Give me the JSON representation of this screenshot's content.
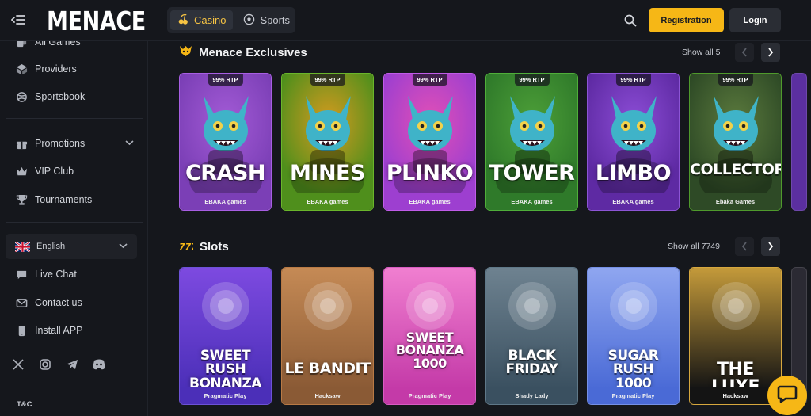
{
  "header": {
    "logo": "MENACE",
    "tabs": [
      {
        "label": "Casino",
        "icon": "cherries-icon"
      },
      {
        "label": "Sports",
        "icon": "soccer-ball-icon"
      }
    ],
    "registration_label": "Registration",
    "login_label": "Login"
  },
  "sidebar": {
    "items": [
      {
        "label": "All Games",
        "icon": "cards-icon"
      },
      {
        "label": "Providers",
        "icon": "cube-icon"
      },
      {
        "label": "Sportsbook",
        "icon": "sportsbook-icon"
      },
      {
        "label": "Promotions",
        "icon": "gift-icon"
      },
      {
        "label": "VIP Club",
        "icon": "crown-icon"
      },
      {
        "label": "Tournaments",
        "icon": "trophy-icon"
      }
    ],
    "language": "English",
    "support_items": [
      {
        "label": "Live Chat",
        "icon": "chat-icon"
      },
      {
        "label": "Contact us",
        "icon": "mail-icon"
      },
      {
        "label": "Install APP",
        "icon": "phone-icon"
      }
    ],
    "socials": [
      "x-icon",
      "instagram-icon",
      "telegram-icon",
      "discord-icon"
    ],
    "tc_label": "T&C"
  },
  "sections": [
    {
      "title": "Menace Exclusives",
      "icon": "menace-icon",
      "show_all": "Show all 5",
      "games": [
        {
          "title": "CRASH",
          "provider": "EBAKA games",
          "rtp": "99% RTP",
          "bg": "#7b3fb6",
          "accent": "#a35bd6",
          "border": "#a85ee3"
        },
        {
          "title": "MINES",
          "provider": "EBAKA games",
          "rtp": "99% RTP",
          "bg": "#4f8f1c",
          "accent": "#d59a1f",
          "border": "#6ab62b"
        },
        {
          "title": "PLINKO",
          "provider": "EBAKA games",
          "rtp": "99% RTP",
          "bg": "#9d3fd0",
          "accent": "#e24fb6",
          "border": "#c05ce8"
        },
        {
          "title": "TOWER",
          "provider": "EBAKA games",
          "rtp": "99% RTP",
          "bg": "#2f7a2a",
          "accent": "#4d9f38",
          "border": "#4fae3a"
        },
        {
          "title": "LIMBO",
          "provider": "EBAKA games",
          "rtp": "99% RTP",
          "bg": "#5e2aa3",
          "accent": "#8c4dd6",
          "border": "#8d55d6"
        },
        {
          "title": "COLLECTOR",
          "provider": "Ebaka Games",
          "rtp": "99% RTP",
          "bg": "#2e4a26",
          "accent": "#5b7a3d",
          "border": "#4f9a2c"
        }
      ]
    },
    {
      "title": "Slots",
      "icon": "slots-777-icon",
      "show_all": "Show all 7749",
      "games": [
        {
          "title": "SWEET RUSH\nBONANZA",
          "provider": "Pragmatic Play",
          "bg": "#4b2fb8",
          "accent": "#7d4ae0",
          "border": "#6d52d6"
        },
        {
          "title": "LE BANDIT",
          "provider": "Hacksaw",
          "bg": "#8a5a35",
          "accent": "#c58a55",
          "border": "#b97a45"
        },
        {
          "title": "SWEET\nBONANZA\n1000",
          "provider": "Pragmatic Play",
          "bg": "#c43aa8",
          "accent": "#f07fd0",
          "border": "#d95cc2"
        },
        {
          "title": "BLACK\nFRIDAY",
          "provider": "Shady Lady",
          "bg": "#3a5060",
          "accent": "#6e8290",
          "border": "#5f7888"
        },
        {
          "title": "SUGAR RUSH\n1000",
          "provider": "Pragmatic Play",
          "bg": "#4a6ad6",
          "accent": "#8fa6f0",
          "border": "#7590e6"
        },
        {
          "title": "THE LUXE",
          "provider": "Hacksaw",
          "bg": "#141414",
          "accent": "#c49a3a",
          "border": "#d6a73e"
        }
      ]
    }
  ]
}
